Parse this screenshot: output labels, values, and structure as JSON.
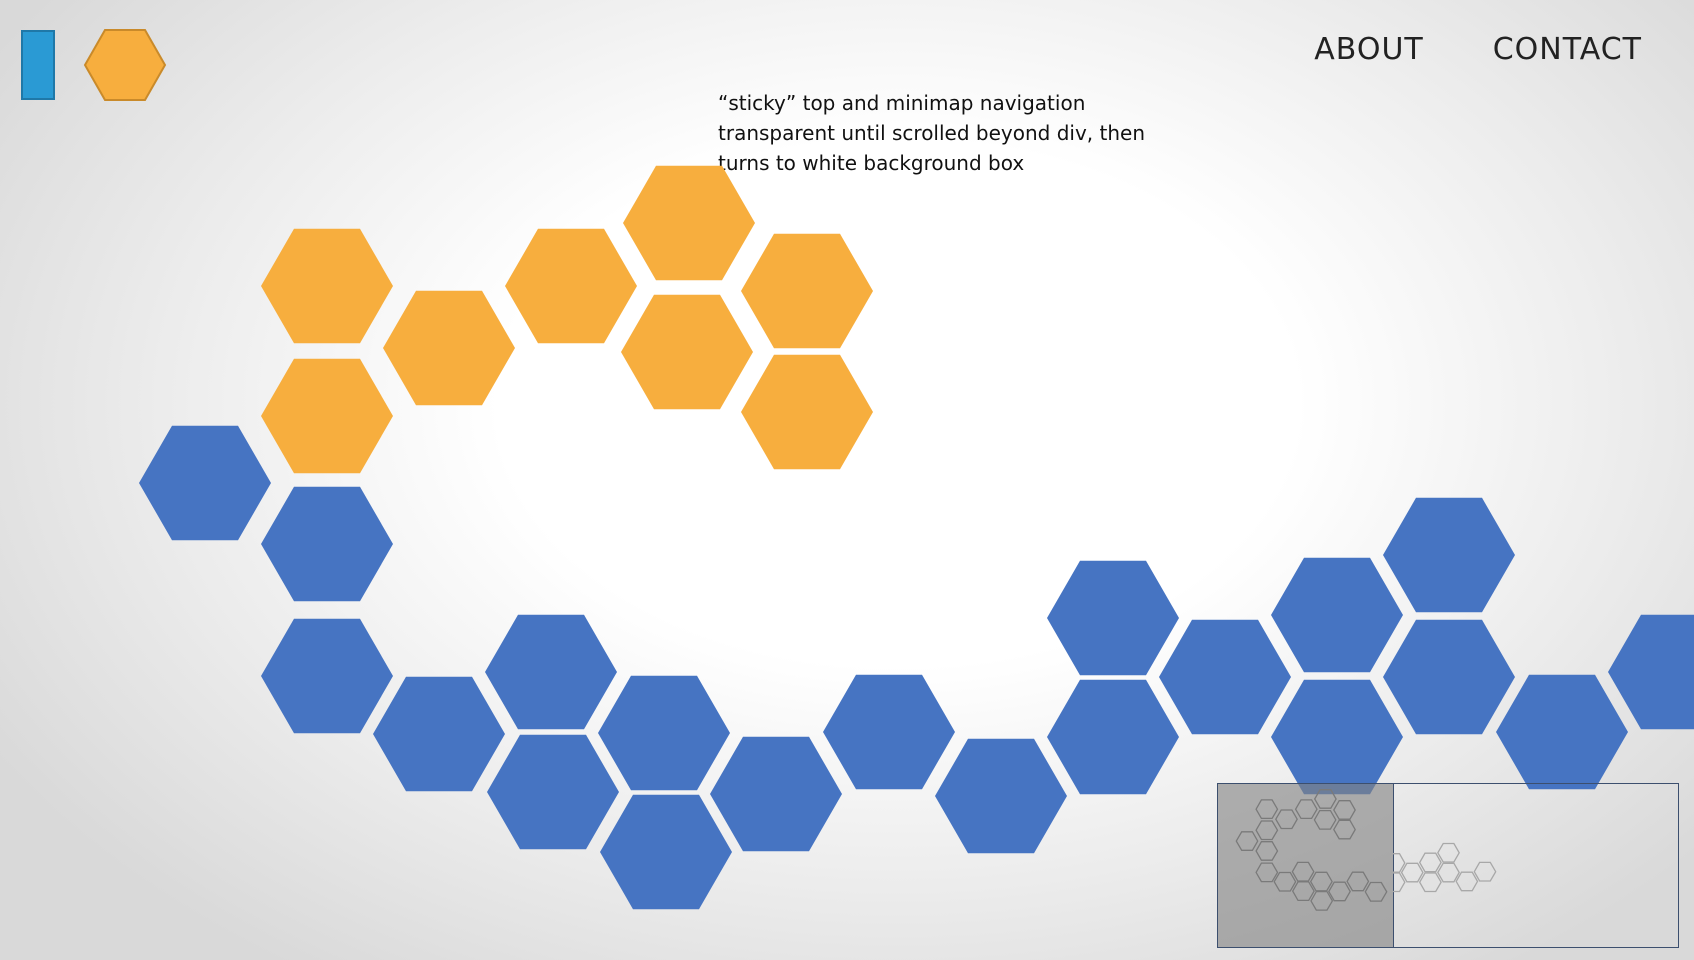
{
  "header": {
    "logo": {
      "rect_color": "#2a9ad4",
      "hex_color": "#f7ae3e"
    },
    "nav": [
      {
        "label": "ABOUT"
      },
      {
        "label": "CONTACT"
      }
    ]
  },
  "annotation": {
    "lines": [
      "“sticky” top and minimap navigation",
      "transparent until scrolled beyond div, then",
      "turns to white background box"
    ]
  },
  "colors": {
    "orange": "#f7ae3e",
    "blue": "#4674c2",
    "minimap_outline_dark": "#7a7a7a",
    "minimap_outline_light": "#a8a8a8"
  }
}
